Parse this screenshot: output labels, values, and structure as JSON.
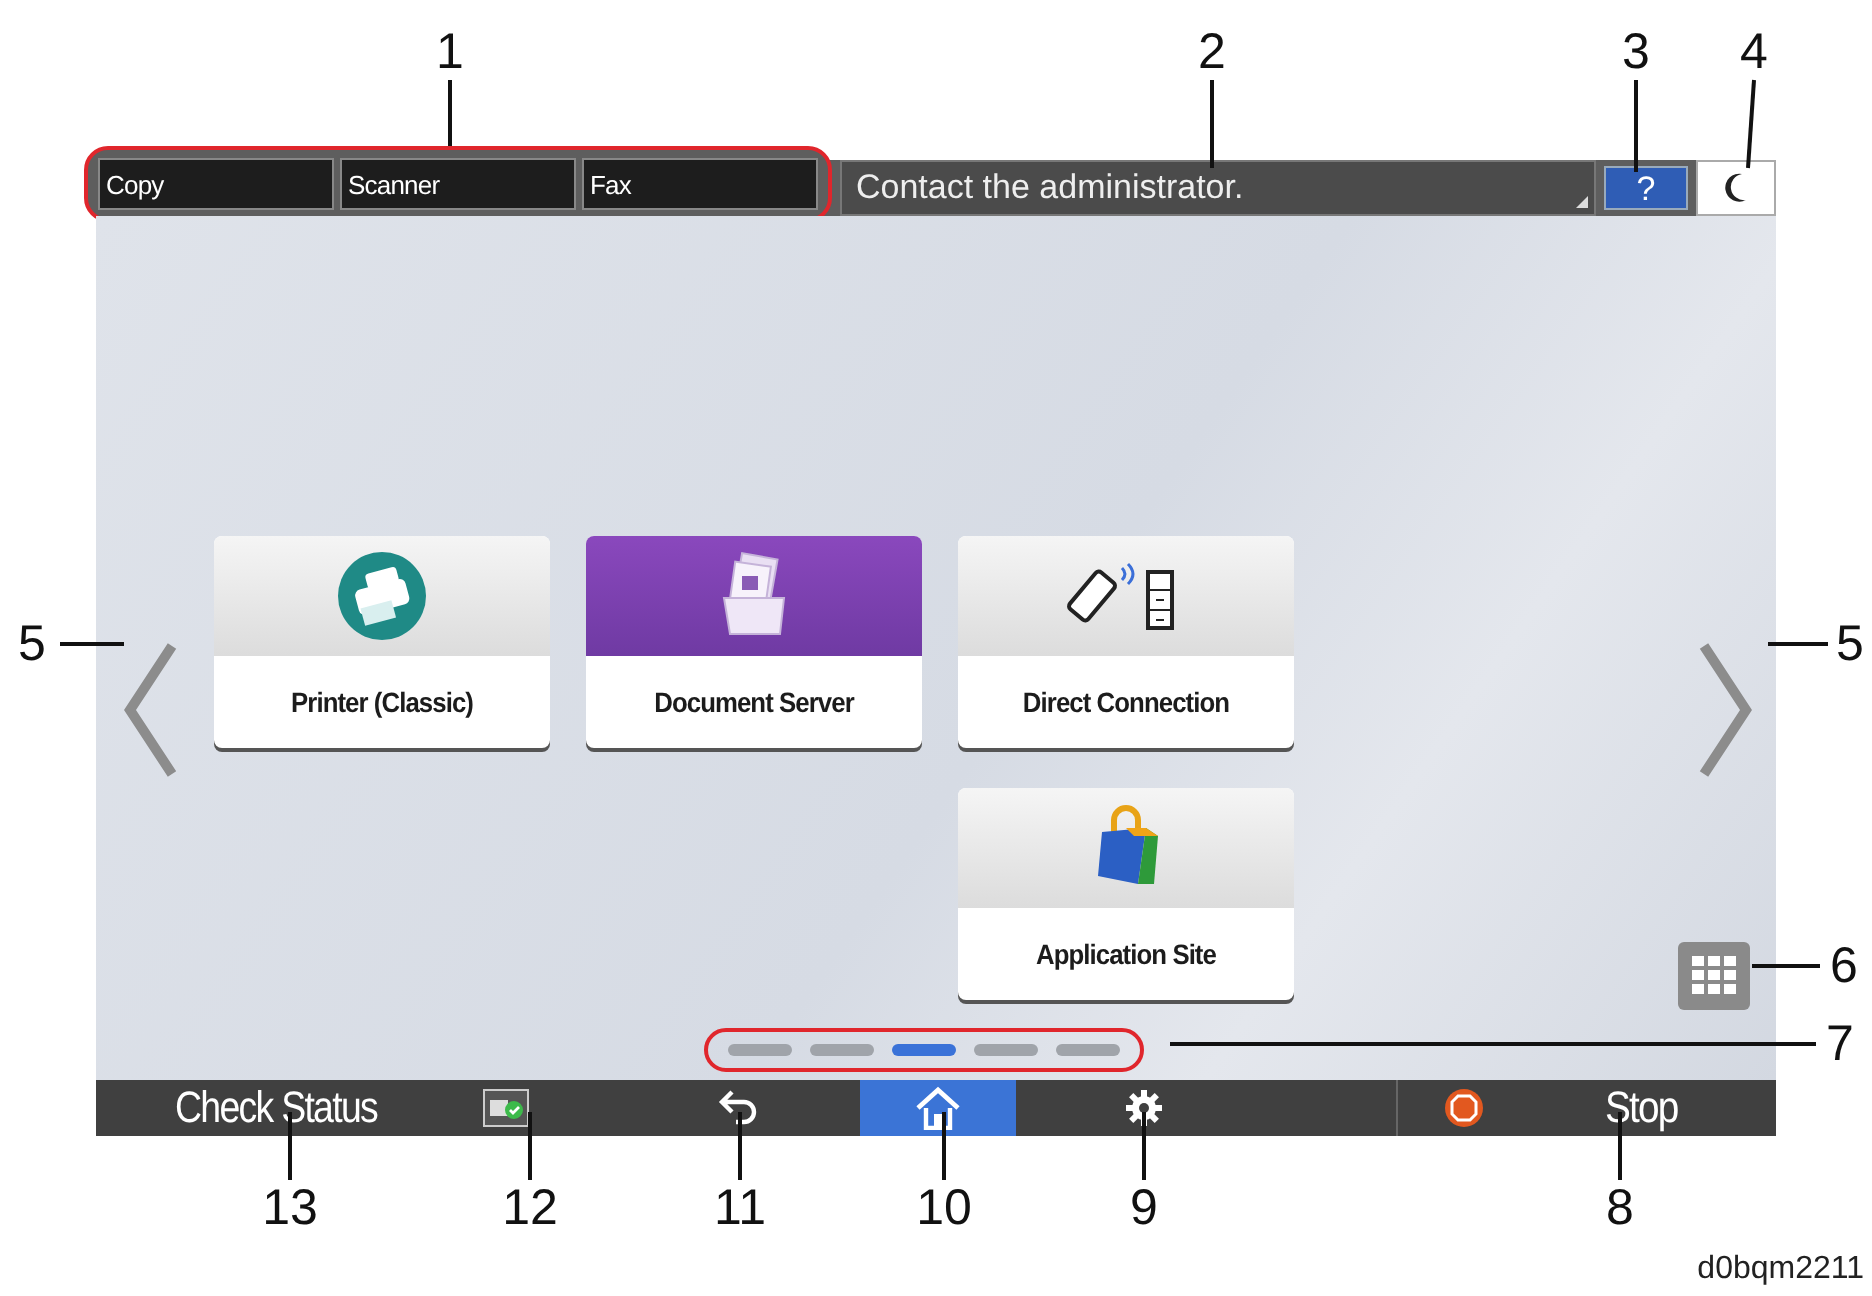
{
  "top_bar": {
    "function_tabs": [
      {
        "label": "Copy"
      },
      {
        "label": "Scanner"
      },
      {
        "label": "Fax"
      }
    ],
    "message": "Contact the administrator.",
    "help_button": "?"
  },
  "apps": [
    {
      "label": "Printer (Classic)",
      "kind": "printer"
    },
    {
      "label": "Document Server",
      "kind": "document-server"
    },
    {
      "label": "Direct Connection",
      "kind": "direct-connection"
    },
    {
      "label": "Application Site",
      "kind": "app-site"
    }
  ],
  "page_dots": [
    {
      "selected": false
    },
    {
      "selected": false
    },
    {
      "selected": true
    },
    {
      "selected": false
    },
    {
      "selected": false
    }
  ],
  "bottom_bar": {
    "check_status": "Check Status",
    "nav_buttons": [
      {
        "kind": "status",
        "selected": false
      },
      {
        "kind": "back",
        "selected": false
      },
      {
        "kind": "home",
        "selected": true
      },
      {
        "kind": "settings",
        "selected": false
      }
    ],
    "stop": "Stop"
  },
  "callouts": [
    {
      "label": "1"
    },
    {
      "label": "2"
    },
    {
      "label": "3"
    },
    {
      "label": "4"
    },
    {
      "label": "5"
    },
    {
      "label": "5"
    },
    {
      "label": "6"
    },
    {
      "label": "7"
    },
    {
      "label": "13"
    },
    {
      "label": "12"
    },
    {
      "label": "11"
    },
    {
      "label": "10"
    },
    {
      "label": "9"
    },
    {
      "label": "8"
    }
  ],
  "figure_id": "d0bqm2211"
}
